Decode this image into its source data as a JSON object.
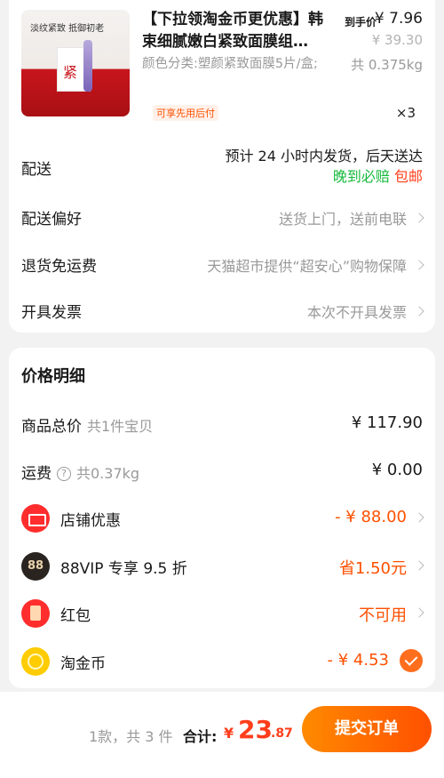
{
  "product": {
    "image_slogan": "淡纹紧致 抵御初老",
    "image_box_text": "紧",
    "title": "【下拉领淘金币更优惠】韩束细腻嫩白紧致面膜组…",
    "spec": "颜色分类:塑颜紧致面膜5片/盒;",
    "paylater_tag": "可享先用后付",
    "price_label": "到手价",
    "price": "¥ 7.96",
    "original_price": "¥ 39.30",
    "weight": "共 0.375kg",
    "quantity": "×3"
  },
  "delivery": {
    "label": "配送",
    "line1": "预计 24 小时内发货，后天送达",
    "line2_green": "晚到必赔",
    "line2_red": "包邮"
  },
  "delivery_pref": {
    "label": "配送偏好",
    "value": "送货上门，送前电联"
  },
  "return": {
    "label": "退货免运费",
    "value": "天猫超市提供“超安心”购物保障"
  },
  "invoice": {
    "label": "开具发票",
    "value": "本次不开具发票"
  },
  "price_detail": {
    "title": "价格明细",
    "total": {
      "label": "商品总价",
      "sub": "共1件宝贝",
      "amount": "¥ 117.90"
    },
    "shipping": {
      "label": "运费",
      "sub": "共0.37kg",
      "amount": "¥ 0.00",
      "help_glyph": "?"
    },
    "store_discount": {
      "label": "店铺优惠",
      "amount": "- ¥ 88.00"
    },
    "vip": {
      "label": "88VIP 专享 9.5 折",
      "icon_text": "88",
      "amount": "省1.50元"
    },
    "redpacket": {
      "label": "红包",
      "amount": "不可用"
    },
    "coin": {
      "label": "淘金币",
      "amount": "- ¥ 4.53"
    }
  },
  "footer": {
    "count": "1款，共 3 件",
    "total_label": "合计:",
    "yen": "¥",
    "total_int": "23",
    "total_dec": ".87",
    "submit_label": "提交订单"
  },
  "colors": {
    "accent": "#ff5000",
    "green": "#15b93b",
    "red": "#ff3d1a"
  }
}
